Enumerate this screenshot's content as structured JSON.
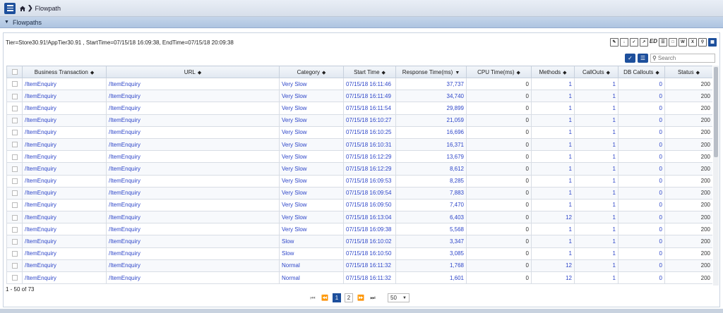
{
  "breadcrumb": {
    "page": "Flowpath"
  },
  "panel": {
    "title": "Flowpaths"
  },
  "info_line": "Tier=Store30.91!AppTier30.91 , StartTime=07/15/18 16:09:38, EndTime=07/15/18 20:09:38",
  "export_icons": [
    "pdf-icon",
    "download-icon",
    "checklist-icon",
    "export-doc-icon",
    "ed-icon",
    "report-icon",
    "pdf-file-icon",
    "word-icon",
    "excel-icon",
    "zoom-icon",
    "grid-icon"
  ],
  "export_ed_label": "ED",
  "search": {
    "placeholder": "Search",
    "value": ""
  },
  "columns": [
    "Business Transaction",
    "URL",
    "Category",
    "Start Time",
    "Response Time(ms)",
    "CPU Time(ms)",
    "Methods",
    "CallOuts",
    "DB Callouts",
    "Status"
  ],
  "rows": [
    [
      "/ItemEnquiry",
      "/ItemEnquiry",
      "Very Slow",
      "07/15/18 16:11:46",
      "37,737",
      "0",
      "1",
      "1",
      "0",
      "200"
    ],
    [
      "/ItemEnquiry",
      "/ItemEnquiry",
      "Very Slow",
      "07/15/18 16:11:49",
      "34,740",
      "0",
      "1",
      "1",
      "0",
      "200"
    ],
    [
      "/ItemEnquiry",
      "/ItemEnquiry",
      "Very Slow",
      "07/15/18 16:11:54",
      "29,899",
      "0",
      "1",
      "1",
      "0",
      "200"
    ],
    [
      "/ItemEnquiry",
      "/ItemEnquiry",
      "Very Slow",
      "07/15/18 16:10:27",
      "21,059",
      "0",
      "1",
      "1",
      "0",
      "200"
    ],
    [
      "/ItemEnquiry",
      "/ItemEnquiry",
      "Very Slow",
      "07/15/18 16:10:25",
      "16,696",
      "0",
      "1",
      "1",
      "0",
      "200"
    ],
    [
      "/ItemEnquiry",
      "/ItemEnquiry",
      "Very Slow",
      "07/15/18 16:10:31",
      "16,371",
      "0",
      "1",
      "1",
      "0",
      "200"
    ],
    [
      "/ItemEnquiry",
      "/ItemEnquiry",
      "Very Slow",
      "07/15/18 16:12:29",
      "13,679",
      "0",
      "1",
      "1",
      "0",
      "200"
    ],
    [
      "/ItemEnquiry",
      "/ItemEnquiry",
      "Very Slow",
      "07/15/18 16:12:29",
      "8,612",
      "0",
      "1",
      "1",
      "0",
      "200"
    ],
    [
      "/ItemEnquiry",
      "/ItemEnquiry",
      "Very Slow",
      "07/15/18 16:09:53",
      "8,285",
      "0",
      "1",
      "1",
      "0",
      "200"
    ],
    [
      "/ItemEnquiry",
      "/ItemEnquiry",
      "Very Slow",
      "07/15/18 16:09:54",
      "7,883",
      "0",
      "1",
      "1",
      "0",
      "200"
    ],
    [
      "/ItemEnquiry",
      "/ItemEnquiry",
      "Very Slow",
      "07/15/18 16:09:50",
      "7,470",
      "0",
      "1",
      "1",
      "0",
      "200"
    ],
    [
      "/ItemEnquiry",
      "/ItemEnquiry",
      "Very Slow",
      "07/15/18 16:13:04",
      "6,403",
      "0",
      "12",
      "1",
      "0",
      "200"
    ],
    [
      "/ItemEnquiry",
      "/ItemEnquiry",
      "Very Slow",
      "07/15/18 16:09:38",
      "5,568",
      "0",
      "1",
      "1",
      "0",
      "200"
    ],
    [
      "/ItemEnquiry",
      "/ItemEnquiry",
      "Slow",
      "07/15/18 16:10:02",
      "3,347",
      "0",
      "1",
      "1",
      "0",
      "200"
    ],
    [
      "/ItemEnquiry",
      "/ItemEnquiry",
      "Slow",
      "07/15/18 16:10:50",
      "3,085",
      "0",
      "1",
      "1",
      "0",
      "200"
    ],
    [
      "/ItemEnquiry",
      "/ItemEnquiry",
      "Normal",
      "07/15/18 16:11:32",
      "1,768",
      "0",
      "12",
      "1",
      "0",
      "200"
    ],
    [
      "/ItemEnquiry",
      "/ItemEnquiry",
      "Normal",
      "07/15/18 16:11:32",
      "1,601",
      "0",
      "12",
      "1",
      "0",
      "200"
    ]
  ],
  "record_range": "1 - 50 of 73",
  "pagination": {
    "pages": [
      "1",
      "2"
    ],
    "current": "1",
    "per_page": "50"
  },
  "colors": {
    "accent": "#1d4f9c",
    "link": "#2d45c8"
  }
}
